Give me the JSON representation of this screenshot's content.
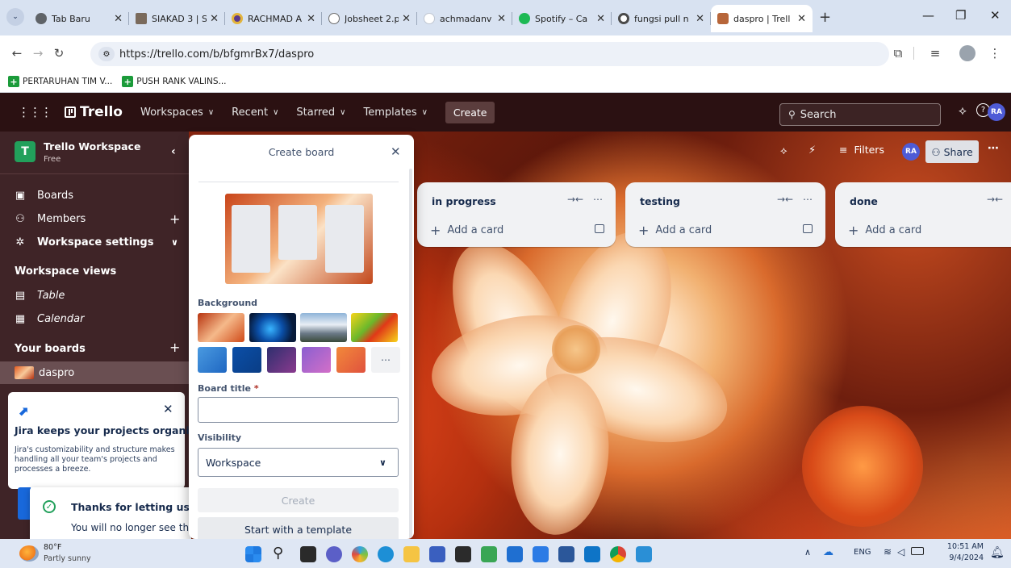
{
  "browser": {
    "tabs": [
      {
        "label": "Tab Baru",
        "fav": "#5f6368",
        "icon": "chrome-newtab-icon"
      },
      {
        "label": "SIAKAD 3 | Si",
        "fav": "#7a6a5c",
        "icon": "siakad-favicon"
      },
      {
        "label": "RACHMAD A",
        "fav": "#5a3a8c",
        "icon": "rachmad-favicon"
      },
      {
        "label": "Jobsheet 2.p",
        "fav": "#6b6b6b",
        "icon": "globe-icon"
      },
      {
        "label": "achmadanv",
        "fav": "#bfc6d1",
        "icon": "github-icon"
      },
      {
        "label": "Spotify – Ca",
        "fav": "#1db954",
        "icon": "spotify-icon"
      },
      {
        "label": "fungsi pull n",
        "fav": "#4a4a4a",
        "icon": "google-icon"
      },
      {
        "label": "daspro | Trell",
        "fav": "#b7663a",
        "icon": "trello-board-favicon"
      }
    ],
    "url": "https://trello.com/b/bfgmrBx7/daspro",
    "bookmarks": [
      "PERTARUHAN TIM V...",
      "PUSH RANK VALINS..."
    ]
  },
  "trello": {
    "logo": "Trello",
    "nav": [
      "Workspaces",
      "Recent",
      "Starred",
      "Templates"
    ],
    "create": "Create",
    "search_placeholder": "Search",
    "avatar": "RA"
  },
  "sidebar": {
    "workspace_initial": "T",
    "workspace_name": "Trello Workspace",
    "workspace_plan": "Free",
    "items": {
      "boards": "Boards",
      "members": "Members",
      "settings": "Workspace settings"
    },
    "views_heading": "Workspace views",
    "views": {
      "table": "Table",
      "calendar": "Calendar"
    },
    "your_boards": "Your boards",
    "board": "daspro"
  },
  "board": {
    "filters": "Filters",
    "share": "Share",
    "avatar": "RA",
    "lists": [
      {
        "title": "in progress",
        "add": "Add a card"
      },
      {
        "title": "testing",
        "add": "Add a card"
      },
      {
        "title": "done",
        "add": "Add a card"
      }
    ]
  },
  "create_board": {
    "title": "Create board",
    "background_label": "Background",
    "board_title_label": "Board title",
    "required_mark": "*",
    "board_title_value": "",
    "visibility_label": "Visibility",
    "visibility_value": "Workspace",
    "create_button": "Create",
    "template_button": "Start with a template",
    "swatches": [
      "#2d7fd2",
      "#0b4fa8",
      "#5b3a86",
      "#a459c8",
      "#e8684a"
    ]
  },
  "jira": {
    "title": "Jira keeps your projects organized",
    "body": "Jira's customizability and structure makes handling all your team's projects and processes a breeze."
  },
  "toast": {
    "title": "Thanks for letting us know",
    "body": "You will no longer see this"
  },
  "taskbar": {
    "temp": "80°F",
    "weather": "Partly sunny",
    "lang": "ENG",
    "time": "10:51 AM",
    "date": "9/4/2024"
  }
}
